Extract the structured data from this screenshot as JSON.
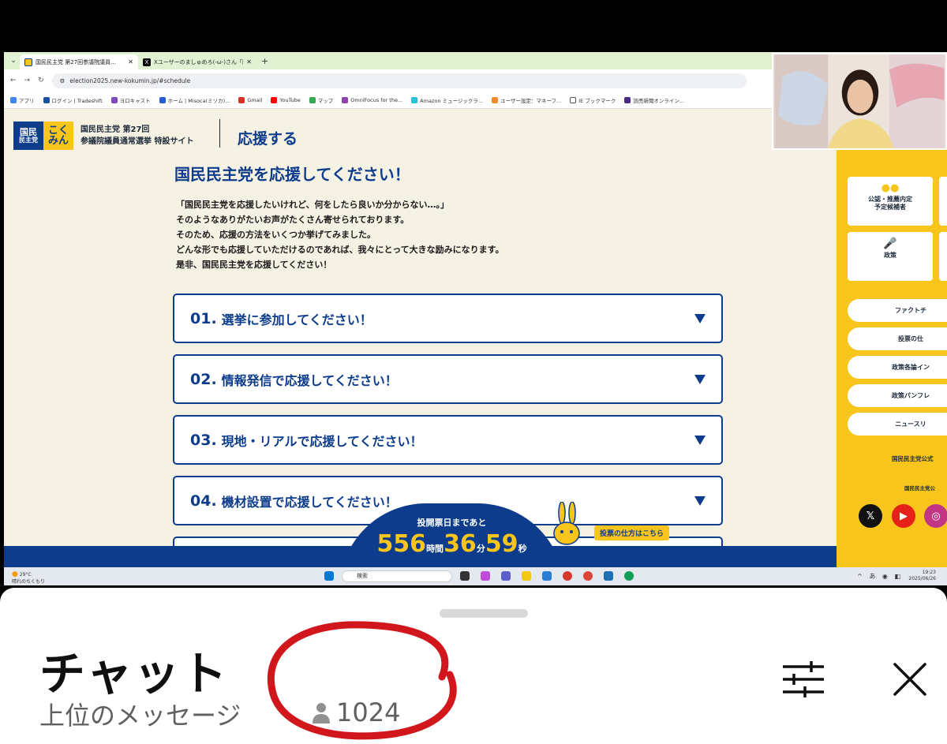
{
  "browser": {
    "tabs": [
      {
        "title": "国民民主党 第27回参議院議員..."
      },
      {
        "title": "Xユーザーのましゅめろ(-ω-)さん「国..."
      }
    ],
    "url": "election2025.new-kokumin.jp/#schedule",
    "bookmarks": [
      "アプリ",
      "ログイン | Tradeshift",
      "ヨロキャスト",
      "ホーム | Misoca(ミソカ)...",
      "Gmail",
      "YouTube",
      "マップ",
      "OmniFocus for the...",
      "Amazon ミュージックラ...",
      "ユーザー設定：マネーフ...",
      "IE ブックマーク",
      "読売新聞オンライン..."
    ]
  },
  "site": {
    "logo_left": [
      "国民",
      "民主党"
    ],
    "logo_right": [
      "こく",
      "みん"
    ],
    "title_line1": "国民民主党 第27回",
    "title_line2": "参議院議員通常選挙 特設サイト",
    "section_title": "応援する",
    "heading": "国民民主党を応援してください！",
    "intro": [
      "「国民民主党を応援したいけれど、何をしたら良いか分からない…。」",
      "そのようなありがたいお声がたくさん寄せられております。",
      "そのため、応援の方法をいくつか挙げてみました。",
      "どんな形でも応援していただけるのであれば、我々にとって大きな励みになります。",
      "是非、国民民主党を応援してください！"
    ],
    "accordion": [
      {
        "num": "01.",
        "label": "選挙に参加してください！"
      },
      {
        "num": "02.",
        "label": "情報発信で応援してください！"
      },
      {
        "num": "03.",
        "label": "現地・リアルで応援してください！"
      },
      {
        "num": "04.",
        "label": "機材設置で応援してください！"
      }
    ],
    "countdown": {
      "label": "投開票日まであと",
      "hours": "556",
      "hours_unit": "時間",
      "minutes": "36",
      "minutes_unit": "分",
      "seconds": "59",
      "seconds_unit": "秒"
    },
    "vote_guide": "投票の仕方はこちら"
  },
  "sidebar": {
    "cards": [
      "公認・推薦内定",
      "予定候補者",
      "政策"
    ],
    "pills": [
      "ファクトチ",
      "投票の仕",
      "政策各論イン",
      "政策パンフレ",
      "ニュースリ"
    ],
    "text1": "国民民主党公式",
    "text2": "国民民主党公"
  },
  "taskbar": {
    "temp": "29°C",
    "weather": "晴れのちくもり",
    "search": "検索",
    "time": "19:23",
    "date": "2025/06/26",
    "tray": "あ"
  },
  "chat": {
    "title": "チャット",
    "subtitle": "上位のメッセージ",
    "viewers": "1024"
  },
  "colors": {
    "navy": "#0d3c8c",
    "yellow": "#f7c51b",
    "annotation_red": "#d1161c"
  }
}
